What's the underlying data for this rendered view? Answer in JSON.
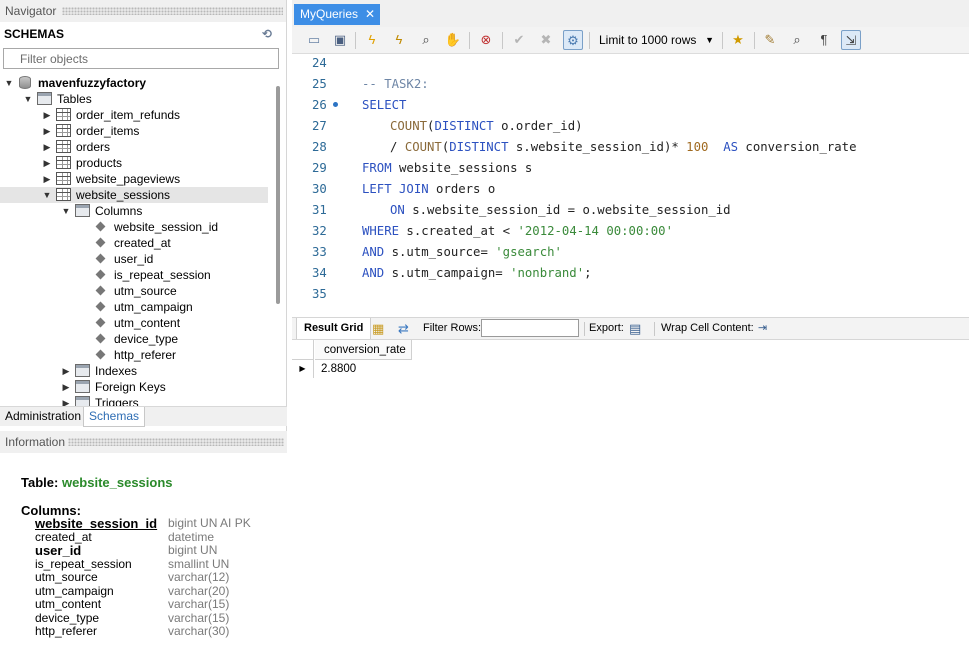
{
  "navigator": {
    "title": "Navigator",
    "schemas_title": "SCHEMAS",
    "filter_placeholder": "Filter objects",
    "schema_name": "mavenfuzzyfactory",
    "tables_label": "Tables",
    "tables": [
      "order_item_refunds",
      "order_items",
      "orders",
      "products",
      "website_pageviews",
      "website_sessions"
    ],
    "columns_label": "Columns",
    "columns": [
      "website_session_id",
      "created_at",
      "user_id",
      "is_repeat_session",
      "utm_source",
      "utm_campaign",
      "utm_content",
      "device_type",
      "http_referer"
    ],
    "subfolders": [
      "Indexes",
      "Foreign Keys",
      "Triggers"
    ]
  },
  "bottom_tabs": {
    "administration": "Administration",
    "schemas": "Schemas"
  },
  "information": {
    "title": "Information",
    "table_prefix": "Table:",
    "table_name": "website_sessions",
    "columns_label": "Columns:",
    "columns": [
      {
        "name": "website_session_id",
        "type": "bigint UN AI PK"
      },
      {
        "name": "created_at",
        "type": "datetime"
      },
      {
        "name": "user_id",
        "type": "bigint UN"
      },
      {
        "name": "is_repeat_session",
        "type": "smallint UN"
      },
      {
        "name": "utm_source",
        "type": "varchar(12)"
      },
      {
        "name": "utm_campaign",
        "type": "varchar(20)"
      },
      {
        "name": "utm_content",
        "type": "varchar(15)"
      },
      {
        "name": "device_type",
        "type": "varchar(15)"
      },
      {
        "name": "http_referer",
        "type": "varchar(30)"
      }
    ]
  },
  "query_tab": {
    "label": "MyQueries",
    "close": "✕"
  },
  "toolbar": {
    "limit_label": "Limit to 1000 rows"
  },
  "editor": {
    "line_numbers": [
      "24",
      "25",
      "26",
      "27",
      "28",
      "29",
      "30",
      "31",
      "32",
      "33",
      "34",
      "35"
    ],
    "lines": {
      "l25": "-- TASK2:",
      "l26": "SELECT",
      "l27_fn": "COUNT",
      "l27_a": "(",
      "l27_kw": "DISTINCT",
      "l27_b": " o.order_id)",
      "l28_a": "/ ",
      "l28_fn": "COUNT",
      "l28_b": "(",
      "l28_kw": "DISTINCT",
      "l28_c": " s.website_session_id)* ",
      "l28_num": "100",
      "l28_kw2": "AS",
      "l28_d": " conversion_rate",
      "l29_kw": "FROM",
      "l29_a": " website_sessions s",
      "l30_kw": "LEFT JOIN",
      "l30_a": " orders o",
      "l31_kw": "ON",
      "l31_a": " s.website_session_id = o.website_session_id",
      "l32_kw": "WHERE",
      "l32_a": " s.created_at < ",
      "l32_str": "'2012-04-14 00:00:00'",
      "l33_kw": "AND",
      "l33_a": " s.utm_source= ",
      "l33_str": "'gsearch'",
      "l34_kw": "AND",
      "l34_a": " s.utm_campaign= ",
      "l34_str": "'nonbrand'",
      "l34_end": ";"
    }
  },
  "results": {
    "result_grid": "Result Grid",
    "filter_rows": "Filter Rows:",
    "export": "Export:",
    "wrap": "Wrap Cell Content:",
    "column": "conversion_rate",
    "value": "2.8800"
  }
}
